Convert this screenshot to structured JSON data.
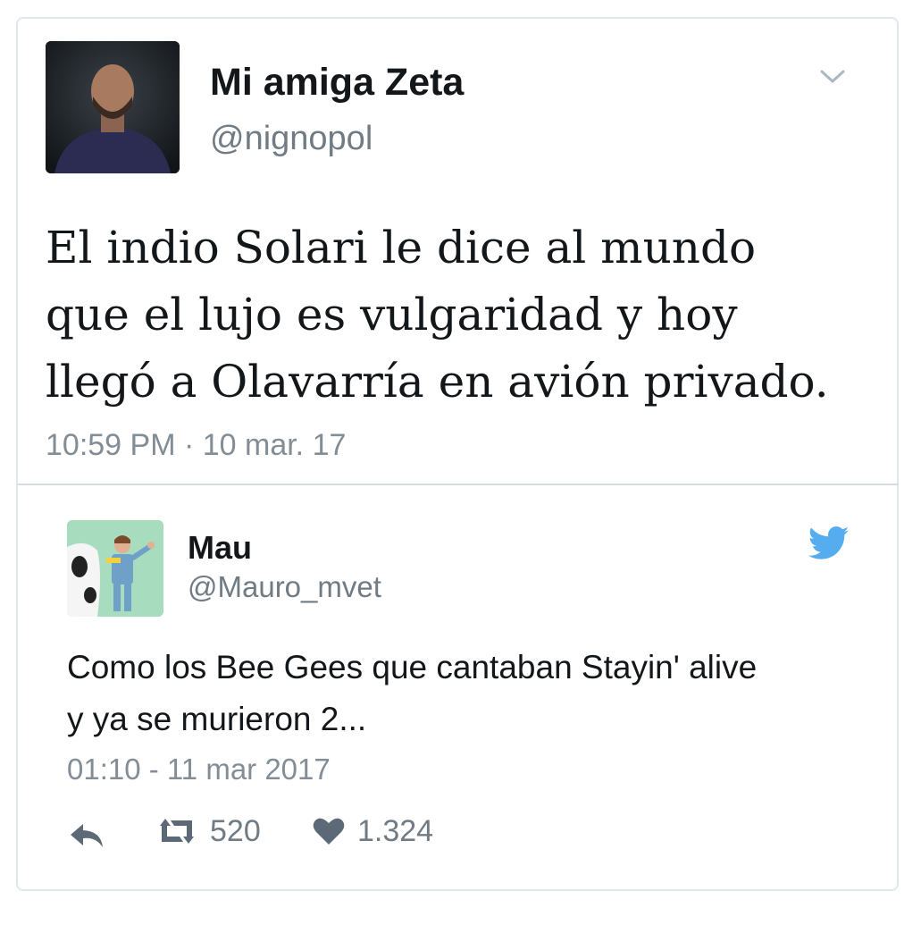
{
  "quoted_screenshot": {
    "author_name": "Mi amiga Zeta",
    "handle": "@nignopol",
    "text_lines": [
      "El indio Solari le dice al mundo",
      "que el lujo es vulgaridad y hoy",
      "llegó a Olavarría en avión privado."
    ],
    "timestamp": "10:59 PM · 10 mar. 17",
    "icons": [
      "chevron-down-icon"
    ]
  },
  "reply": {
    "author_name": "Mau",
    "handle": "@Mauro_mvet",
    "text_lines": [
      "Como los Bee Gees que cantaban Stayin' alive",
      "y ya se murieron 2..."
    ],
    "timestamp": "01:10 - 11 mar 2017",
    "retweet_count": "520",
    "like_count": "1.324",
    "icons": [
      "twitter-bird-icon",
      "reply-icon",
      "retweet-icon",
      "heart-icon"
    ],
    "colors": {
      "bird": "#55acee",
      "action_icon": "#5b6a76"
    }
  }
}
